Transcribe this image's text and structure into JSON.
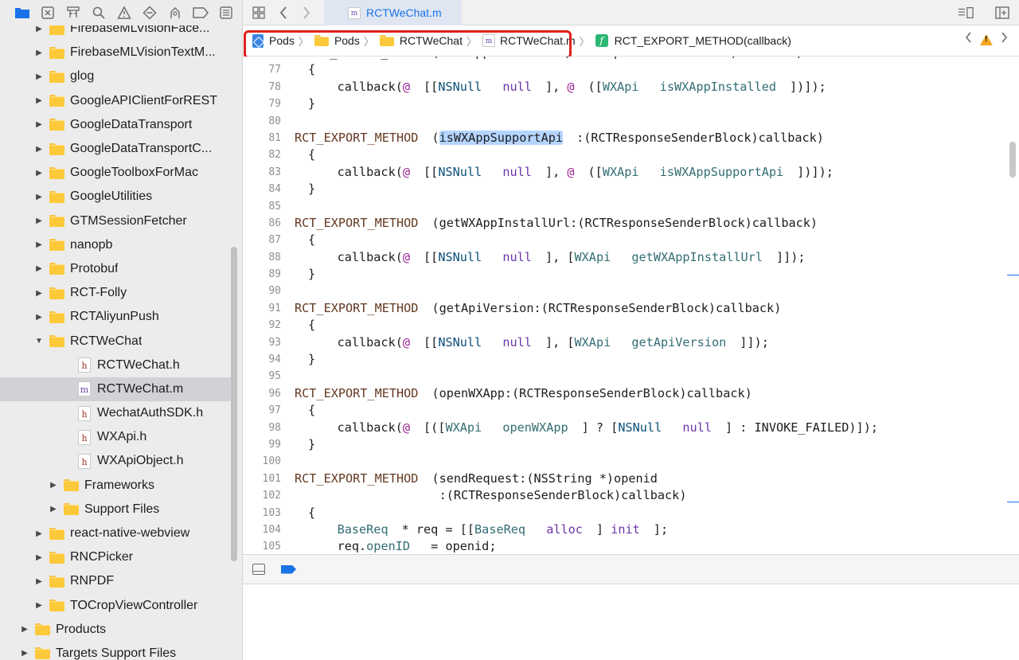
{
  "navigator": {
    "toolbar_icons": [
      "folder-icon",
      "source-control-icon",
      "hierarchy-icon",
      "find-icon",
      "issue-icon",
      "test-icon",
      "debug-icon",
      "breakpoint-icon",
      "report-icon"
    ],
    "tree": [
      {
        "label": "FirebaseMLVisionFace...",
        "type": "folder",
        "depth": 1,
        "expanded": false
      },
      {
        "label": "FirebaseMLVisionTextM...",
        "type": "folder",
        "depth": 1,
        "expanded": false
      },
      {
        "label": "glog",
        "type": "folder",
        "depth": 1,
        "expanded": false
      },
      {
        "label": "GoogleAPIClientForREST",
        "type": "folder",
        "depth": 1,
        "expanded": false
      },
      {
        "label": "GoogleDataTransport",
        "type": "folder",
        "depth": 1,
        "expanded": false
      },
      {
        "label": "GoogleDataTransportC...",
        "type": "folder",
        "depth": 1,
        "expanded": false
      },
      {
        "label": "GoogleToolboxForMac",
        "type": "folder",
        "depth": 1,
        "expanded": false
      },
      {
        "label": "GoogleUtilities",
        "type": "folder",
        "depth": 1,
        "expanded": false
      },
      {
        "label": "GTMSessionFetcher",
        "type": "folder",
        "depth": 1,
        "expanded": false
      },
      {
        "label": "nanopb",
        "type": "folder",
        "depth": 1,
        "expanded": false
      },
      {
        "label": "Protobuf",
        "type": "folder",
        "depth": 1,
        "expanded": false
      },
      {
        "label": "RCT-Folly",
        "type": "folder",
        "depth": 1,
        "expanded": false
      },
      {
        "label": "RCTAliyunPush",
        "type": "folder",
        "depth": 1,
        "expanded": false
      },
      {
        "label": "RCTWeChat",
        "type": "folder",
        "depth": 1,
        "expanded": true
      },
      {
        "label": "RCTWeChat.h",
        "type": "h",
        "depth": 2
      },
      {
        "label": "RCTWeChat.m",
        "type": "m",
        "depth": 2,
        "selected": true
      },
      {
        "label": "WechatAuthSDK.h",
        "type": "h",
        "depth": 2
      },
      {
        "label": "WXApi.h",
        "type": "h",
        "depth": 2
      },
      {
        "label": "WXApiObject.h",
        "type": "h",
        "depth": 2
      },
      {
        "label": "Frameworks",
        "type": "folder",
        "depth": 2,
        "expanded": false
      },
      {
        "label": "Support Files",
        "type": "folder",
        "depth": 2,
        "expanded": false
      },
      {
        "label": "react-native-webview",
        "type": "folder",
        "depth": 1,
        "expanded": false
      },
      {
        "label": "RNCPicker",
        "type": "folder",
        "depth": 1,
        "expanded": false
      },
      {
        "label": "RNPDF",
        "type": "folder",
        "depth": 1,
        "expanded": false
      },
      {
        "label": "TOCropViewController",
        "type": "folder",
        "depth": 1,
        "expanded": false
      },
      {
        "label": "Products",
        "type": "folder",
        "depth": 0,
        "expanded": false
      },
      {
        "label": "Targets Support Files",
        "type": "folder",
        "depth": 0,
        "expanded": false
      }
    ]
  },
  "tabbar": {
    "active_tab": "RCTWeChat.m"
  },
  "jumpbar": {
    "crumbs": [
      {
        "label": "Pods",
        "icon": "project"
      },
      {
        "label": "Pods",
        "icon": "folder"
      },
      {
        "label": "RCTWeChat",
        "icon": "folder"
      },
      {
        "label": "RCTWeChat.m",
        "icon": "m-file"
      }
    ],
    "symbol": "RCT_EXPORT_METHOD(callback)",
    "highlight_color": "#e0201b"
  },
  "code": {
    "lines": [
      {
        "n": "",
        "tokens": [
          [
            "src",
            "RCT_EXPORT_METHOD(isWXAppInstalled:(RCTResponseSenderBlock)callback)"
          ]
        ]
      },
      {
        "n": "77",
        "tokens": [
          [
            "src",
            "{"
          ]
        ]
      },
      {
        "n": "78",
        "tokens": [
          [
            "src",
            "    callback("
          ],
          [
            "kw-objc",
            "@"
          ],
          [
            "src",
            "[["
          ],
          [
            "cls",
            "NSNull"
          ],
          [
            "src",
            " "
          ],
          [
            "meth-sys",
            "null"
          ],
          [
            "src",
            "], "
          ],
          [
            "kw-objc",
            "@"
          ],
          [
            "src",
            "(["
          ],
          [
            "cls-proj",
            "WXApi"
          ],
          [
            "src",
            " "
          ],
          [
            "meth",
            "isWXAppInstalled"
          ],
          [
            "src",
            "])]);"
          ]
        ]
      },
      {
        "n": "79",
        "tokens": [
          [
            "src",
            "}"
          ]
        ]
      },
      {
        "n": "80",
        "tokens": []
      },
      {
        "n": "81",
        "tokens": [
          [
            "kw-macro",
            "RCT_EXPORT_METHOD"
          ],
          [
            "src",
            "("
          ],
          [
            "hl",
            "isWXAppSupportApi"
          ],
          [
            "src",
            ":(RCTResponseSenderBlock)callback)"
          ]
        ]
      },
      {
        "n": "82",
        "tokens": [
          [
            "src",
            "{"
          ]
        ]
      },
      {
        "n": "83",
        "tokens": [
          [
            "src",
            "    callback("
          ],
          [
            "kw-objc",
            "@"
          ],
          [
            "src",
            "[["
          ],
          [
            "cls",
            "NSNull"
          ],
          [
            "src",
            " "
          ],
          [
            "meth-sys",
            "null"
          ],
          [
            "src",
            "], "
          ],
          [
            "kw-objc",
            "@"
          ],
          [
            "src",
            "(["
          ],
          [
            "cls-proj",
            "WXApi"
          ],
          [
            "src",
            " "
          ],
          [
            "meth",
            "isWXAppSupportApi"
          ],
          [
            "src",
            "])]);"
          ]
        ]
      },
      {
        "n": "84",
        "tokens": [
          [
            "src",
            "}"
          ]
        ]
      },
      {
        "n": "85",
        "tokens": []
      },
      {
        "n": "86",
        "tokens": [
          [
            "kw-macro",
            "RCT_EXPORT_METHOD"
          ],
          [
            "src",
            "(getWXAppInstallUrl:(RCTResponseSenderBlock)callback)"
          ]
        ]
      },
      {
        "n": "87",
        "tokens": [
          [
            "src",
            "{"
          ]
        ]
      },
      {
        "n": "88",
        "tokens": [
          [
            "src",
            "    callback("
          ],
          [
            "kw-objc",
            "@"
          ],
          [
            "src",
            "[["
          ],
          [
            "cls",
            "NSNull"
          ],
          [
            "src",
            " "
          ],
          [
            "meth-sys",
            "null"
          ],
          [
            "src",
            "], ["
          ],
          [
            "cls-proj",
            "WXApi"
          ],
          [
            "src",
            " "
          ],
          [
            "meth",
            "getWXAppInstallUrl"
          ],
          [
            "src",
            "]]);"
          ]
        ]
      },
      {
        "n": "89",
        "tokens": [
          [
            "src",
            "}"
          ]
        ]
      },
      {
        "n": "90",
        "tokens": []
      },
      {
        "n": "91",
        "tokens": [
          [
            "kw-macro",
            "RCT_EXPORT_METHOD"
          ],
          [
            "src",
            "(getApiVersion:(RCTResponseSenderBlock)callback)"
          ]
        ]
      },
      {
        "n": "92",
        "tokens": [
          [
            "src",
            "{"
          ]
        ]
      },
      {
        "n": "93",
        "tokens": [
          [
            "src",
            "    callback("
          ],
          [
            "kw-objc",
            "@"
          ],
          [
            "src",
            "[["
          ],
          [
            "cls",
            "NSNull"
          ],
          [
            "src",
            " "
          ],
          [
            "meth-sys",
            "null"
          ],
          [
            "src",
            "], ["
          ],
          [
            "cls-proj",
            "WXApi"
          ],
          [
            "src",
            " "
          ],
          [
            "meth",
            "getApiVersion"
          ],
          [
            "src",
            "]]);"
          ]
        ]
      },
      {
        "n": "94",
        "tokens": [
          [
            "src",
            "}"
          ]
        ]
      },
      {
        "n": "95",
        "tokens": []
      },
      {
        "n": "96",
        "tokens": [
          [
            "kw-macro",
            "RCT_EXPORT_METHOD"
          ],
          [
            "src",
            "(openWXApp:(RCTResponseSenderBlock)callback)"
          ]
        ]
      },
      {
        "n": "97",
        "tokens": [
          [
            "src",
            "{"
          ]
        ]
      },
      {
        "n": "98",
        "tokens": [
          [
            "src",
            "    callback("
          ],
          [
            "kw-objc",
            "@"
          ],
          [
            "src",
            "[(["
          ],
          [
            "cls-proj",
            "WXApi"
          ],
          [
            "src",
            " "
          ],
          [
            "meth",
            "openWXApp"
          ],
          [
            "src",
            "] ? ["
          ],
          [
            "cls",
            "NSNull"
          ],
          [
            "src",
            " "
          ],
          [
            "meth-sys",
            "null"
          ],
          [
            "src",
            "] : INVOKE_FAILED)]);"
          ]
        ]
      },
      {
        "n": "99",
        "tokens": [
          [
            "src",
            "}"
          ]
        ]
      },
      {
        "n": "100",
        "tokens": []
      },
      {
        "n": "101",
        "tokens": [
          [
            "kw-macro",
            "RCT_EXPORT_METHOD"
          ],
          [
            "src",
            "(sendRequest:(NSString *)openid"
          ]
        ]
      },
      {
        "n": "102",
        "tokens": [
          [
            "src",
            "                  :(RCTResponseSenderBlock)callback)"
          ]
        ]
      },
      {
        "n": "103",
        "tokens": [
          [
            "src",
            "{"
          ]
        ]
      },
      {
        "n": "104",
        "tokens": [
          [
            "src",
            "    "
          ],
          [
            "cls-proj",
            "BaseReq"
          ],
          [
            "src",
            "* req = [["
          ],
          [
            "cls-proj",
            "BaseReq"
          ],
          [
            "src",
            " "
          ],
          [
            "meth-sys",
            "alloc"
          ],
          [
            "src",
            "] "
          ],
          [
            "meth-sys",
            "init"
          ],
          [
            "src",
            "];"
          ]
        ]
      },
      {
        "n": "105",
        "tokens": [
          [
            "src",
            "    req."
          ],
          [
            "meth",
            "openID"
          ],
          [
            "src",
            " = openid;"
          ]
        ]
      }
    ]
  }
}
